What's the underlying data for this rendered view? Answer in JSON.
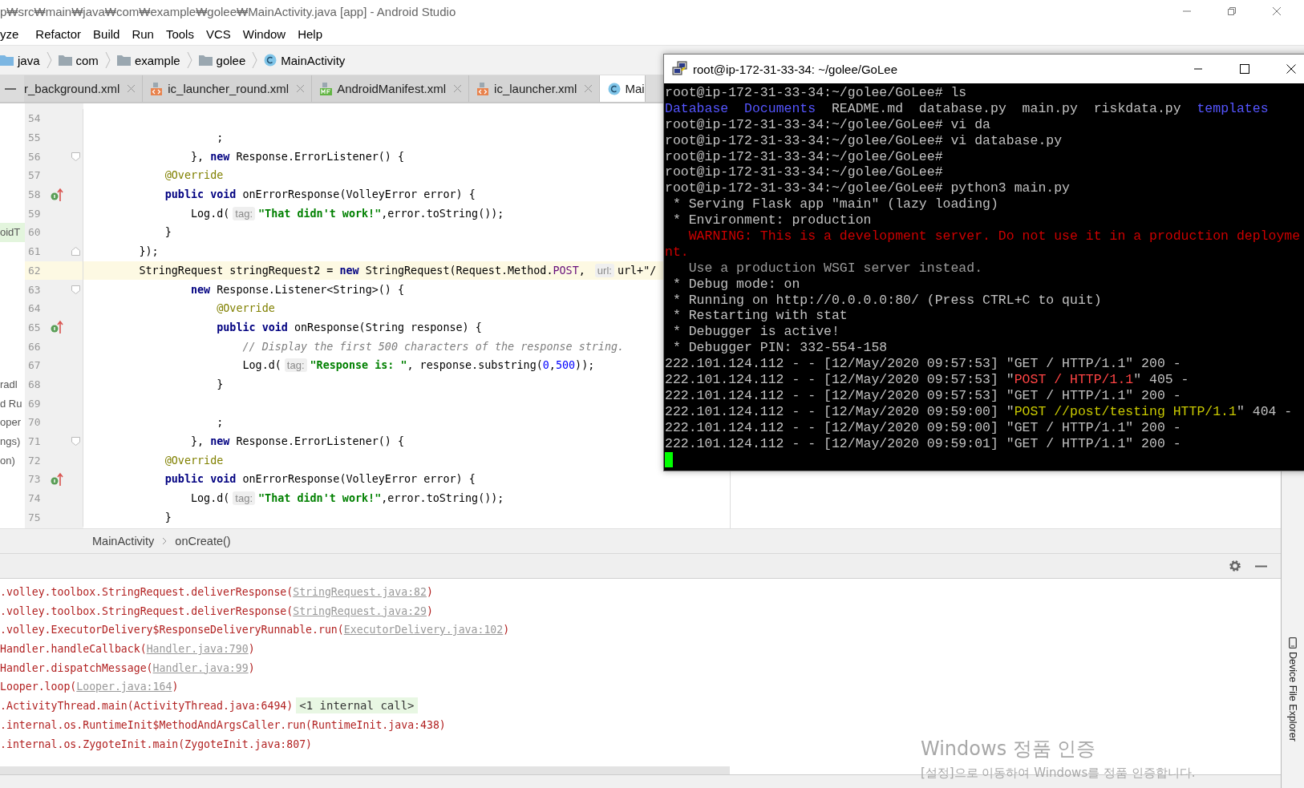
{
  "window": {
    "title": "p₩src₩main₩java₩com₩example₩golee₩MainActivity.java [app] - Android Studio"
  },
  "menu": [
    "yze",
    "Refactor",
    "Build",
    "Run",
    "Tools",
    "VCS",
    "Window",
    "Help"
  ],
  "breadcrumb": [
    {
      "label": "java",
      "kind": "source-folder"
    },
    {
      "label": "com",
      "kind": "folder"
    },
    {
      "label": "example",
      "kind": "folder"
    },
    {
      "label": "golee",
      "kind": "folder"
    },
    {
      "label": "MainActivity",
      "kind": "class"
    }
  ],
  "tabs": [
    {
      "label": "r_background.xml",
      "selected": false,
      "closable": true
    },
    {
      "label": "ic_launcher_round.xml",
      "kind": "xml",
      "selected": false,
      "closable": true
    },
    {
      "label": "AndroidManifest.xml",
      "kind": "manifest",
      "selected": false,
      "closable": true
    },
    {
      "label": "ic_launcher.xml",
      "kind": "xml",
      "selected": false,
      "closable": true
    },
    {
      "label": "Mai",
      "kind": "class",
      "selected": true,
      "closable": false
    }
  ],
  "code_lines": [
    {
      "number": "54",
      "current": false,
      "override": false
    },
    {
      "number": "55",
      "current": false,
      "override": false,
      "tokens": [
        {
          "kind": "plain",
          "text": "                    ;"
        }
      ]
    },
    {
      "number": "56",
      "current": false,
      "override": false,
      "fold": {
        "kind": "start"
      },
      "tokens": [
        {
          "kind": "plain",
          "text": "                }, "
        },
        {
          "kind": "keyword",
          "text": "new"
        },
        {
          "kind": "plain",
          "text": " Response.ErrorListener() {"
        }
      ]
    },
    {
      "number": "57",
      "current": false,
      "override": false,
      "tokens": [
        {
          "kind": "annotation",
          "text": "            @Override"
        }
      ]
    },
    {
      "number": "58",
      "current": false,
      "override": true,
      "tokens": [
        {
          "kind": "keyword",
          "text": "            public void"
        },
        {
          "kind": "plain",
          "text": " onErrorResponse(VolleyError error) {"
        }
      ]
    },
    {
      "number": "59",
      "current": false,
      "override": false,
      "tokens": [
        {
          "kind": "plain",
          "text": "                Log.d("
        },
        {
          "kind": "hint",
          "text": "tag:"
        },
        {
          "kind": "string",
          "text": "\"That didn't work!\""
        },
        {
          "kind": "plain",
          "text": ",error.toString());"
        }
      ]
    },
    {
      "number": "60",
      "current": false,
      "override": false,
      "panel": {
        "text": "oidT",
        "selected": true
      },
      "tokens": [
        {
          "kind": "plain",
          "text": "            }"
        }
      ]
    },
    {
      "number": "61",
      "current": false,
      "override": false,
      "fold": {
        "kind": "end"
      },
      "tokens": [
        {
          "kind": "plain",
          "text": "        });"
        }
      ]
    },
    {
      "number": "62",
      "current": true,
      "override": false,
      "tokens": [
        {
          "kind": "plain",
          "text": "        StringRequest stringRequest2 = "
        },
        {
          "kind": "keyword",
          "text": "new"
        },
        {
          "kind": "plain",
          "text": " StringRequest(Request.Method."
        },
        {
          "kind": "constant",
          "text": "POST"
        },
        {
          "kind": "plain",
          "text": ", "
        },
        {
          "kind": "hint",
          "text": "url:"
        },
        {
          "kind": "plain",
          "text": "url+\"/"
        }
      ]
    },
    {
      "number": "63",
      "current": false,
      "override": false,
      "fold": {
        "kind": "start"
      },
      "tokens": [
        {
          "kind": "keyword",
          "text": "                new"
        },
        {
          "kind": "plain",
          "text": " Response.Listener<String>() {"
        }
      ]
    },
    {
      "number": "64",
      "current": false,
      "override": false,
      "tokens": [
        {
          "kind": "annotation",
          "text": "                    @Override"
        }
      ]
    },
    {
      "number": "65",
      "current": false,
      "override": true,
      "tokens": [
        {
          "kind": "keyword",
          "text": "                    public void"
        },
        {
          "kind": "plain",
          "text": " onResponse(String response) {"
        }
      ]
    },
    {
      "number": "66",
      "current": false,
      "override": false,
      "tokens": [
        {
          "kind": "comment",
          "text": "                        // Display the first 500 characters of the response string."
        }
      ]
    },
    {
      "number": "67",
      "current": false,
      "override": false,
      "tokens": [
        {
          "kind": "plain",
          "text": "                        Log.d("
        },
        {
          "kind": "hint",
          "text": "tag:"
        },
        {
          "kind": "string",
          "text": "\"Response is: \""
        },
        {
          "kind": "plain",
          "text": ", response.substring("
        },
        {
          "kind": "number",
          "text": "0"
        },
        {
          "kind": "plain",
          "text": ","
        },
        {
          "kind": "number",
          "text": "500"
        },
        {
          "kind": "plain",
          "text": "));"
        }
      ]
    },
    {
      "number": "68",
      "current": false,
      "override": false,
      "panel": {
        "text": "radl",
        "selected": false
      },
      "tokens": [
        {
          "kind": "plain",
          "text": "                    }"
        }
      ]
    },
    {
      "number": "69",
      "current": false,
      "override": false,
      "panel": {
        "text": "d Ru",
        "selected": false
      }
    },
    {
      "number": "70",
      "current": false,
      "override": false,
      "panel": {
        "text": "oper",
        "selected": false
      },
      "tokens": [
        {
          "kind": "plain",
          "text": "                    ;"
        }
      ]
    },
    {
      "number": "71",
      "current": false,
      "override": false,
      "fold": {
        "kind": "start"
      },
      "panel": {
        "text": "ngs)",
        "selected": false
      },
      "tokens": [
        {
          "kind": "plain",
          "text": "                }, "
        },
        {
          "kind": "keyword",
          "text": "new"
        },
        {
          "kind": "plain",
          "text": " Response.ErrorListener() {"
        }
      ]
    },
    {
      "number": "72",
      "current": false,
      "override": false,
      "panel": {
        "text": "on)",
        "selected": false
      },
      "tokens": [
        {
          "kind": "annotation",
          "text": "            @Override"
        }
      ]
    },
    {
      "number": "73",
      "current": false,
      "override": true,
      "tokens": [
        {
          "kind": "keyword",
          "text": "            public void"
        },
        {
          "kind": "plain",
          "text": " onErrorResponse(VolleyError error) {"
        }
      ]
    },
    {
      "number": "74",
      "current": false,
      "override": false,
      "tokens": [
        {
          "kind": "plain",
          "text": "                Log.d("
        },
        {
          "kind": "hint",
          "text": "tag:"
        },
        {
          "kind": "string",
          "text": "\"That didn't work!\""
        },
        {
          "kind": "plain",
          "text": ",error.toString());"
        }
      ]
    },
    {
      "number": "75",
      "current": false,
      "override": false,
      "tokens": [
        {
          "kind": "plain",
          "text": "            }"
        }
      ]
    }
  ],
  "editor_breadcrumb": [
    "MainActivity",
    "onCreate()"
  ],
  "log_lines": [
    {
      "segments": [
        {
          "kind": "text",
          "text": ".volley.toolbox.StringRequest.deliverResponse("
        },
        {
          "kind": "link",
          "text": "StringRequest.java:82"
        },
        {
          "kind": "text",
          "text": ")"
        }
      ]
    },
    {
      "segments": [
        {
          "kind": "text",
          "text": ".volley.toolbox.StringRequest.deliverResponse("
        },
        {
          "kind": "link",
          "text": "StringRequest.java:29"
        },
        {
          "kind": "text",
          "text": ")"
        }
      ]
    },
    {
      "segments": [
        {
          "kind": "text",
          "text": ".volley.ExecutorDelivery$ResponseDeliveryRunnable.run("
        },
        {
          "kind": "link",
          "text": "ExecutorDelivery.java:102"
        },
        {
          "kind": "text",
          "text": ")"
        }
      ]
    },
    {
      "segments": [
        {
          "kind": "text",
          "text": "Handler.handleCallback("
        },
        {
          "kind": "link",
          "text": "Handler.java:790"
        },
        {
          "kind": "text",
          "text": ")"
        }
      ]
    },
    {
      "segments": [
        {
          "kind": "text",
          "text": "Handler.dispatchMessage("
        },
        {
          "kind": "link",
          "text": "Handler.java:99"
        },
        {
          "kind": "text",
          "text": ")"
        }
      ]
    },
    {
      "segments": [
        {
          "kind": "text",
          "text": "Looper.loop("
        },
        {
          "kind": "link",
          "text": "Looper.java:164"
        },
        {
          "kind": "text",
          "text": ")"
        }
      ]
    },
    {
      "segments": [
        {
          "kind": "text",
          "text": ".ActivityThread.main(ActivityThread.java:6494)"
        },
        {
          "kind": "folded",
          "text": "<1 internal call>"
        }
      ]
    },
    {
      "segments": [
        {
          "kind": "text",
          "text": ".internal.os.RuntimeInit$MethodAndArgsCaller.run(RuntimeInit.java:438)"
        }
      ]
    },
    {
      "segments": [
        {
          "kind": "text",
          "text": ".internal.os.ZygoteInit.main(ZygoteInit.java:807)"
        }
      ]
    }
  ],
  "side_tool": "Device File Explorer",
  "terminal": {
    "title": "root@ip-172-31-33-34: ~/golee/GoLee",
    "lines": [
      {
        "segments": [
          {
            "kind": "plain",
            "text": "root@ip-172-31-33-34:~/golee/GoLee# ls"
          }
        ]
      },
      {
        "segments": [
          {
            "kind": "directory",
            "text": "Database  "
          },
          {
            "kind": "directory",
            "text": "Documents  "
          },
          {
            "kind": "plain",
            "text": "README.md  database.py  main.py  riskdata.py  "
          },
          {
            "kind": "directory",
            "text": "templates"
          }
        ]
      },
      {
        "segments": [
          {
            "kind": "plain",
            "text": "root@ip-172-31-33-34:~/golee/GoLee# vi da"
          }
        ]
      },
      {
        "segments": [
          {
            "kind": "plain",
            "text": "root@ip-172-31-33-34:~/golee/GoLee# vi database.py"
          }
        ]
      },
      {
        "segments": [
          {
            "kind": "plain",
            "text": "root@ip-172-31-33-34:~/golee/GoLee#"
          }
        ]
      },
      {
        "segments": [
          {
            "kind": "plain",
            "text": "root@ip-172-31-33-34:~/golee/GoLee#"
          }
        ]
      },
      {
        "segments": [
          {
            "kind": "plain",
            "text": "root@ip-172-31-33-34:~/golee/GoLee# python3 main.py"
          }
        ]
      },
      {
        "segments": [
          {
            "kind": "plain",
            "text": " * Serving Flask app \"main\" (lazy loading)"
          }
        ]
      },
      {
        "segments": [
          {
            "kind": "plain",
            "text": " * Environment: production"
          }
        ]
      },
      {
        "segments": [
          {
            "kind": "error",
            "text": "   WARNING: This is a development server. Do not use it in a production deployme"
          }
        ]
      },
      {
        "segments": [
          {
            "kind": "error",
            "text": "nt."
          }
        ]
      },
      {
        "segments": [
          {
            "kind": "dim",
            "text": "   Use a production WSGI server instead."
          }
        ]
      },
      {
        "segments": [
          {
            "kind": "plain",
            "text": " * Debug mode: on"
          }
        ]
      },
      {
        "segments": [
          {
            "kind": "plain",
            "text": " * Running on http://0.0.0.0:80/ (Press CTRL+C to quit)"
          }
        ]
      },
      {
        "segments": [
          {
            "kind": "plain",
            "text": " * Restarting with stat"
          }
        ]
      },
      {
        "segments": [
          {
            "kind": "plain",
            "text": " * Debugger is active!"
          }
        ]
      },
      {
        "segments": [
          {
            "kind": "plain",
            "text": " * Debugger PIN: 332-554-158"
          }
        ]
      },
      {
        "segments": [
          {
            "kind": "plain",
            "text": "222.101.124.112 - - [12/May/2020 09:57:53] \"GET / HTTP/1.1\" 200 -"
          }
        ]
      },
      {
        "segments": [
          {
            "kind": "plain",
            "text": "222.101.124.112 - - [12/May/2020 09:57:53] \""
          },
          {
            "kind": "bright-error",
            "text": "POST / HTTP/1.1"
          },
          {
            "kind": "plain",
            "text": "\" 405 -"
          }
        ]
      },
      {
        "segments": [
          {
            "kind": "plain",
            "text": "222.101.124.112 - - [12/May/2020 09:57:53] \"GET / HTTP/1.1\" 200 -"
          }
        ]
      },
      {
        "segments": [
          {
            "kind": "plain",
            "text": "222.101.124.112 - - [12/May/2020 09:59:00] \""
          },
          {
            "kind": "warning",
            "text": "POST //post/testing HTTP/1.1"
          },
          {
            "kind": "plain",
            "text": "\" 404 -"
          }
        ]
      },
      {
        "segments": [
          {
            "kind": "plain",
            "text": "222.101.124.112 - - [12/May/2020 09:59:00] \"GET / HTTP/1.1\" 200 -"
          }
        ]
      },
      {
        "segments": [
          {
            "kind": "plain",
            "text": "222.101.124.112 - - [12/May/2020 09:59:01] \"GET / HTTP/1.1\" 200 -"
          }
        ]
      }
    ]
  },
  "activation_notice": {
    "title": "Windows 정품 인증",
    "message": "[설정]으로 이동하여 Windows를 정품 인증합니다."
  }
}
